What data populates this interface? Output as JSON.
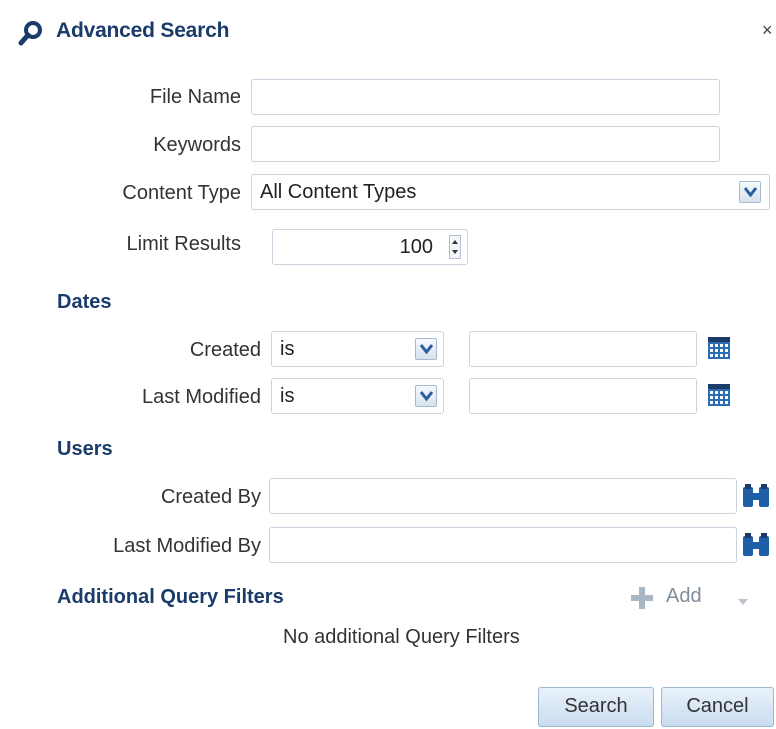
{
  "dialog": {
    "title": "Advanced Search",
    "close_label": "×",
    "icons": {
      "title": "search-icon",
      "close": "close-icon",
      "calendar": "calendar-icon",
      "user_picker": "binoculars-icon",
      "add": "plus-icon"
    },
    "colors": {
      "title": "#1b3b6b",
      "button_bg": "#c9dcef",
      "calendar": "#2a6db5"
    }
  },
  "fields": {
    "file_name": {
      "label": "File Name",
      "value": ""
    },
    "keywords": {
      "label": "Keywords",
      "value": ""
    },
    "content_type": {
      "label": "Content Type",
      "value": "All Content Types"
    },
    "limit_results": {
      "label": "Limit Results",
      "value": "100"
    }
  },
  "dates": {
    "heading": "Dates",
    "created": {
      "label": "Created",
      "operator": "is",
      "value": ""
    },
    "last_modified": {
      "label": "Last Modified",
      "operator": "is",
      "value": ""
    }
  },
  "users": {
    "heading": "Users",
    "created_by": {
      "label": "Created By",
      "value": ""
    },
    "last_modified_by": {
      "label": "Last Modified By",
      "value": ""
    }
  },
  "filters": {
    "heading": "Additional Query Filters",
    "add_label": "Add",
    "empty_text": "No additional Query Filters"
  },
  "actions": {
    "search_label": "Search",
    "cancel_label": "Cancel"
  }
}
